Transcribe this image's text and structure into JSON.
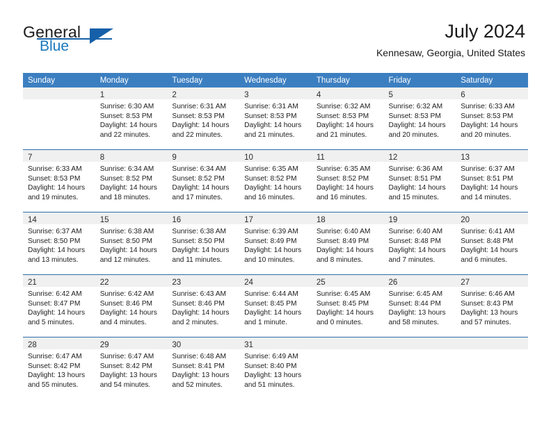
{
  "brand": {
    "word1": "General",
    "word2": "Blue",
    "logo_icon": "triangle-icon",
    "accent_color": "#1560a8"
  },
  "header": {
    "month_title": "July 2024",
    "location": "Kennesaw, Georgia, United States"
  },
  "theme": {
    "header_row_bg": "#3c7fc1",
    "row_divider": "#2e6da4",
    "daynum_band_bg": "#f0f0f0",
    "page_bg": "#ffffff"
  },
  "calendar": {
    "weekday_headers": [
      "Sunday",
      "Monday",
      "Tuesday",
      "Wednesday",
      "Thursday",
      "Friday",
      "Saturday"
    ],
    "weeks": [
      [
        {
          "day": "",
          "lines": []
        },
        {
          "day": "1",
          "lines": [
            "Sunrise: 6:30 AM",
            "Sunset: 8:53 PM",
            "Daylight: 14 hours",
            "and 22 minutes."
          ]
        },
        {
          "day": "2",
          "lines": [
            "Sunrise: 6:31 AM",
            "Sunset: 8:53 PM",
            "Daylight: 14 hours",
            "and 22 minutes."
          ]
        },
        {
          "day": "3",
          "lines": [
            "Sunrise: 6:31 AM",
            "Sunset: 8:53 PM",
            "Daylight: 14 hours",
            "and 21 minutes."
          ]
        },
        {
          "day": "4",
          "lines": [
            "Sunrise: 6:32 AM",
            "Sunset: 8:53 PM",
            "Daylight: 14 hours",
            "and 21 minutes."
          ]
        },
        {
          "day": "5",
          "lines": [
            "Sunrise: 6:32 AM",
            "Sunset: 8:53 PM",
            "Daylight: 14 hours",
            "and 20 minutes."
          ]
        },
        {
          "day": "6",
          "lines": [
            "Sunrise: 6:33 AM",
            "Sunset: 8:53 PM",
            "Daylight: 14 hours",
            "and 20 minutes."
          ]
        }
      ],
      [
        {
          "day": "7",
          "lines": [
            "Sunrise: 6:33 AM",
            "Sunset: 8:53 PM",
            "Daylight: 14 hours",
            "and 19 minutes."
          ]
        },
        {
          "day": "8",
          "lines": [
            "Sunrise: 6:34 AM",
            "Sunset: 8:52 PM",
            "Daylight: 14 hours",
            "and 18 minutes."
          ]
        },
        {
          "day": "9",
          "lines": [
            "Sunrise: 6:34 AM",
            "Sunset: 8:52 PM",
            "Daylight: 14 hours",
            "and 17 minutes."
          ]
        },
        {
          "day": "10",
          "lines": [
            "Sunrise: 6:35 AM",
            "Sunset: 8:52 PM",
            "Daylight: 14 hours",
            "and 16 minutes."
          ]
        },
        {
          "day": "11",
          "lines": [
            "Sunrise: 6:35 AM",
            "Sunset: 8:52 PM",
            "Daylight: 14 hours",
            "and 16 minutes."
          ]
        },
        {
          "day": "12",
          "lines": [
            "Sunrise: 6:36 AM",
            "Sunset: 8:51 PM",
            "Daylight: 14 hours",
            "and 15 minutes."
          ]
        },
        {
          "day": "13",
          "lines": [
            "Sunrise: 6:37 AM",
            "Sunset: 8:51 PM",
            "Daylight: 14 hours",
            "and 14 minutes."
          ]
        }
      ],
      [
        {
          "day": "14",
          "lines": [
            "Sunrise: 6:37 AM",
            "Sunset: 8:50 PM",
            "Daylight: 14 hours",
            "and 13 minutes."
          ]
        },
        {
          "day": "15",
          "lines": [
            "Sunrise: 6:38 AM",
            "Sunset: 8:50 PM",
            "Daylight: 14 hours",
            "and 12 minutes."
          ]
        },
        {
          "day": "16",
          "lines": [
            "Sunrise: 6:38 AM",
            "Sunset: 8:50 PM",
            "Daylight: 14 hours",
            "and 11 minutes."
          ]
        },
        {
          "day": "17",
          "lines": [
            "Sunrise: 6:39 AM",
            "Sunset: 8:49 PM",
            "Daylight: 14 hours",
            "and 10 minutes."
          ]
        },
        {
          "day": "18",
          "lines": [
            "Sunrise: 6:40 AM",
            "Sunset: 8:49 PM",
            "Daylight: 14 hours",
            "and 8 minutes."
          ]
        },
        {
          "day": "19",
          "lines": [
            "Sunrise: 6:40 AM",
            "Sunset: 8:48 PM",
            "Daylight: 14 hours",
            "and 7 minutes."
          ]
        },
        {
          "day": "20",
          "lines": [
            "Sunrise: 6:41 AM",
            "Sunset: 8:48 PM",
            "Daylight: 14 hours",
            "and 6 minutes."
          ]
        }
      ],
      [
        {
          "day": "21",
          "lines": [
            "Sunrise: 6:42 AM",
            "Sunset: 8:47 PM",
            "Daylight: 14 hours",
            "and 5 minutes."
          ]
        },
        {
          "day": "22",
          "lines": [
            "Sunrise: 6:42 AM",
            "Sunset: 8:46 PM",
            "Daylight: 14 hours",
            "and 4 minutes."
          ]
        },
        {
          "day": "23",
          "lines": [
            "Sunrise: 6:43 AM",
            "Sunset: 8:46 PM",
            "Daylight: 14 hours",
            "and 2 minutes."
          ]
        },
        {
          "day": "24",
          "lines": [
            "Sunrise: 6:44 AM",
            "Sunset: 8:45 PM",
            "Daylight: 14 hours",
            "and 1 minute."
          ]
        },
        {
          "day": "25",
          "lines": [
            "Sunrise: 6:45 AM",
            "Sunset: 8:45 PM",
            "Daylight: 14 hours",
            "and 0 minutes."
          ]
        },
        {
          "day": "26",
          "lines": [
            "Sunrise: 6:45 AM",
            "Sunset: 8:44 PM",
            "Daylight: 13 hours",
            "and 58 minutes."
          ]
        },
        {
          "day": "27",
          "lines": [
            "Sunrise: 6:46 AM",
            "Sunset: 8:43 PM",
            "Daylight: 13 hours",
            "and 57 minutes."
          ]
        }
      ],
      [
        {
          "day": "28",
          "lines": [
            "Sunrise: 6:47 AM",
            "Sunset: 8:42 PM",
            "Daylight: 13 hours",
            "and 55 minutes."
          ]
        },
        {
          "day": "29",
          "lines": [
            "Sunrise: 6:47 AM",
            "Sunset: 8:42 PM",
            "Daylight: 13 hours",
            "and 54 minutes."
          ]
        },
        {
          "day": "30",
          "lines": [
            "Sunrise: 6:48 AM",
            "Sunset: 8:41 PM",
            "Daylight: 13 hours",
            "and 52 minutes."
          ]
        },
        {
          "day": "31",
          "lines": [
            "Sunrise: 6:49 AM",
            "Sunset: 8:40 PM",
            "Daylight: 13 hours",
            "and 51 minutes."
          ]
        },
        {
          "day": "",
          "lines": []
        },
        {
          "day": "",
          "lines": []
        },
        {
          "day": "",
          "lines": []
        }
      ]
    ]
  }
}
